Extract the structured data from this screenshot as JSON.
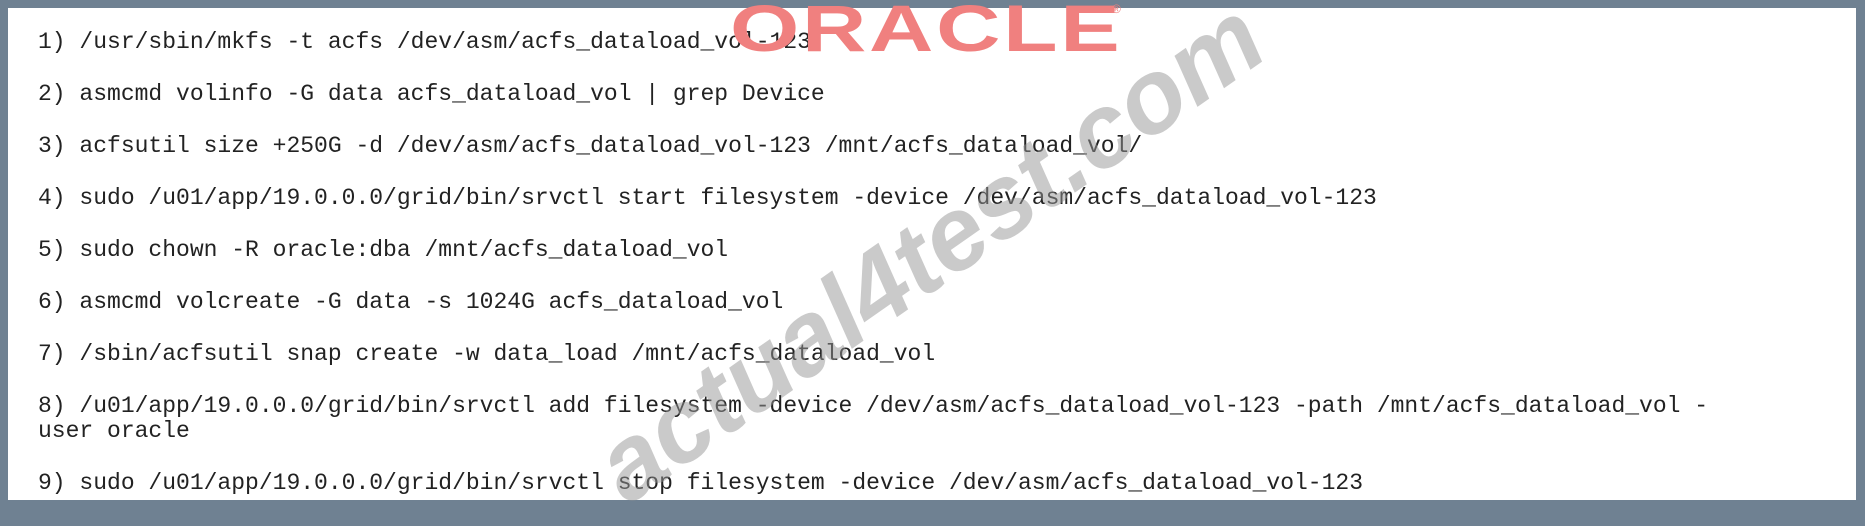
{
  "logo": {
    "text": "ORACLE",
    "mark": "®",
    "color": "#f0807f"
  },
  "watermark": "actual4test.com",
  "lines": [
    "1) /usr/sbin/mkfs -t acfs /dev/asm/acfs_dataload_vol-123",
    "2) asmcmd volinfo -G data acfs_dataload_vol | grep Device",
    "3) acfsutil size +250G -d /dev/asm/acfs_dataload_vol-123 /mnt/acfs_dataload_vol/",
    "4) sudo /u01/app/19.0.0.0/grid/bin/srvctl start filesystem -device /dev/asm/acfs_dataload_vol-123",
    "5) sudo chown -R oracle:dba /mnt/acfs_dataload_vol",
    "6) asmcmd volcreate -G data -s 1024G acfs_dataload_vol",
    "7) /sbin/acfsutil snap create -w data_load /mnt/acfs_dataload_vol",
    "8) /u01/app/19.0.0.0/grid/bin/srvctl add filesystem -device /dev/asm/acfs_dataload_vol-123 -path /mnt/acfs_dataload_vol -",
    "user oracle",
    "9) sudo /u01/app/19.0.0.0/grid/bin/srvctl stop filesystem -device /dev/asm/acfs_dataload_vol-123"
  ]
}
